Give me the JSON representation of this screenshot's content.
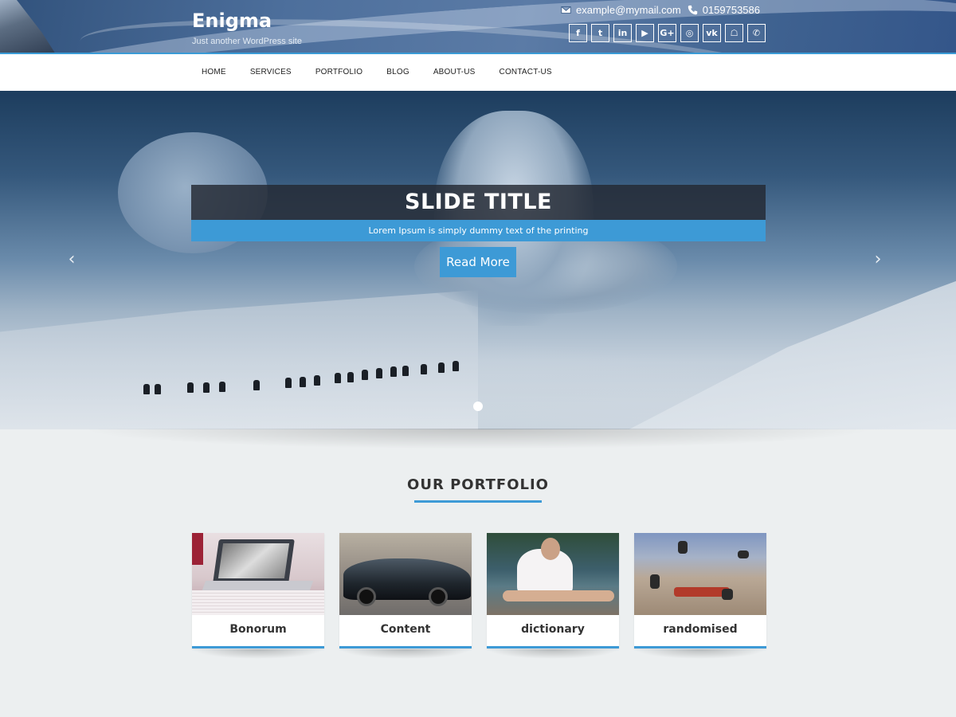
{
  "header": {
    "site_title": "Enigma",
    "tagline": "Just another WordPress site",
    "email": "example@mymail.com",
    "phone": "0159753586",
    "socials": [
      {
        "name": "facebook",
        "glyph": "f"
      },
      {
        "name": "twitter",
        "glyph": "t"
      },
      {
        "name": "linkedin",
        "glyph": "in"
      },
      {
        "name": "youtube",
        "glyph": "▶"
      },
      {
        "name": "google-plus",
        "glyph": "G+"
      },
      {
        "name": "instagram",
        "glyph": "◎"
      },
      {
        "name": "vk",
        "glyph": "vk"
      },
      {
        "name": "snapchat",
        "glyph": "☖"
      },
      {
        "name": "whatsapp",
        "glyph": "✆"
      }
    ]
  },
  "nav": {
    "items": [
      "HOME",
      "SERVICES",
      "PORTFOLIO",
      "BLOG",
      "ABOUT-US",
      "CONTACT-US"
    ]
  },
  "slider": {
    "title": "SLIDE TITLE",
    "description": "Lorem Ipsum is simply dummy text of the printing",
    "button": "Read More",
    "prev_glyph": "‹",
    "next_glyph": "›"
  },
  "portfolio": {
    "heading": "OUR PORTFOLIO",
    "items": [
      "Bonorum",
      "Content",
      "dictionary",
      "randomised"
    ]
  },
  "colors": {
    "accent": "#3d9ad6",
    "background": "#eceff0"
  }
}
